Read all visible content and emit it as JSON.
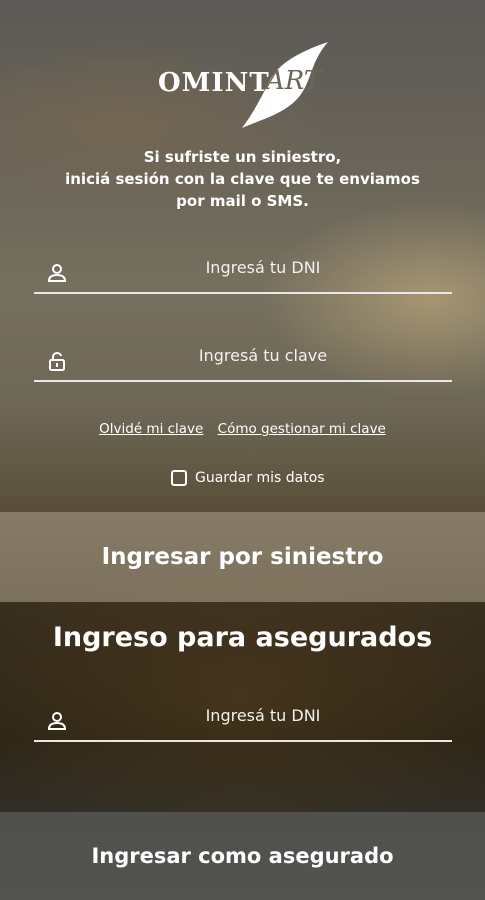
{
  "logo": {
    "brand": "OMINT",
    "product": "ART"
  },
  "intro_text": "Si sufriste un siniestro,\niniciá sesión con la clave que te enviamos\npor mail o SMS.",
  "siniestro_form": {
    "dni": {
      "placeholder": "Ingresá tu DNI",
      "value": "",
      "icon": "user-icon"
    },
    "clave": {
      "placeholder": "Ingresá tu clave",
      "value": "",
      "icon": "lock-icon"
    },
    "forgot_link": "Olvidé mi clave",
    "manage_link": "Cómo gestionar mi clave",
    "remember_label": "Guardar mis datos",
    "remember_checked": false,
    "submit_label": "Ingresar por siniestro"
  },
  "asegurados_form": {
    "title": "Ingreso para asegurados",
    "dni": {
      "placeholder": "Ingresá tu DNI",
      "value": "",
      "icon": "user-icon"
    },
    "submit_label": "Ingresar como asegurado"
  }
}
